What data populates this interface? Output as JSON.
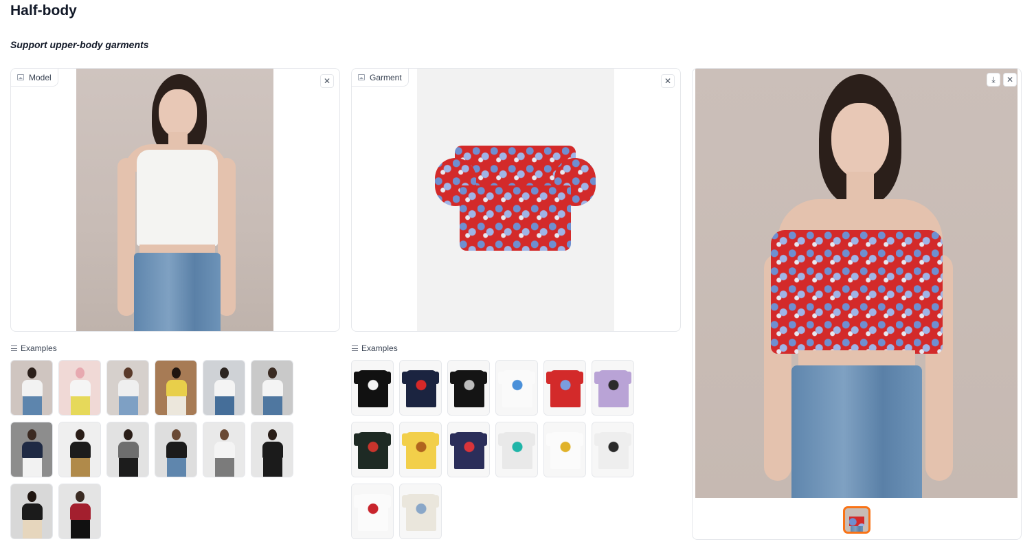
{
  "header": {
    "title": "Half-body",
    "subtitle": "Support upper-body garments"
  },
  "model_panel": {
    "label": "Model",
    "clear_icon": "close-icon"
  },
  "garment_panel": {
    "label": "Garment",
    "clear_icon": "close-icon"
  },
  "result_panel": {
    "download_icon": "download-icon",
    "close_icon": "close-icon"
  },
  "model_examples": {
    "label": "Examples",
    "items": [
      {
        "bg": "#cfc5c0",
        "head": "#2b1f1a",
        "top": "#f2f2f2",
        "bottom": "#5d85ad"
      },
      {
        "bg": "#f0d9d6",
        "head": "#e7a9b0",
        "top": "#f5f5f5",
        "bottom": "#e6d95a"
      },
      {
        "bg": "#d6d0cc",
        "head": "#5a3a2a",
        "top": "#efefef",
        "bottom": "#7ea0c4"
      },
      {
        "bg": "#a77b55",
        "head": "#1f1510",
        "top": "#e8cf4a",
        "bottom": "#ece7dc"
      },
      {
        "bg": "#cfd2d6",
        "head": "#2b2420",
        "top": "#f4f4f4",
        "bottom": "#456e99"
      },
      {
        "bg": "#c9c9c9",
        "head": "#3a2b22",
        "top": "#f4f4f4",
        "bottom": "#4f77a0"
      },
      {
        "bg": "#8d8d8d",
        "head": "#3b2a22",
        "top": "#1f2a44",
        "bottom": "#f2f2f2"
      },
      {
        "bg": "#efefef",
        "head": "#2a1e18",
        "top": "#1c1c1c",
        "bottom": "#b08a4a"
      },
      {
        "bg": "#e2e2e2",
        "head": "#2a1e18",
        "top": "#6e6e6e",
        "bottom": "#1c1c1c"
      },
      {
        "bg": "#dedede",
        "head": "#6a4a35",
        "top": "#1b1b1b",
        "bottom": "#5f86ad"
      },
      {
        "bg": "#e9e9e9",
        "head": "#6a4a35",
        "top": "#f4f4f4",
        "bottom": "#7b7b7b"
      },
      {
        "bg": "#e6e6e6",
        "head": "#2a1e18",
        "top": "#1b1b1b",
        "bottom": "#1b1b1b"
      },
      {
        "bg": "#d8d8d8",
        "head": "#1f1510",
        "top": "#1b1b1b",
        "bottom": "#e6d6bd"
      },
      {
        "bg": "#e4e4e4",
        "head": "#3a2b22",
        "top": "#a31f2e",
        "bottom": "#111111"
      }
    ]
  },
  "garment_examples": {
    "label": "Examples",
    "items": [
      {
        "bg": "#f7f7f7",
        "shirt": "#111111",
        "accent": "#f3f3f3"
      },
      {
        "bg": "#f7f7f7",
        "shirt": "#1b2440",
        "accent": "#d62828"
      },
      {
        "bg": "#f7f7f7",
        "shirt": "#141414",
        "accent": "#bdbdbd"
      },
      {
        "bg": "#f7f7f7",
        "shirt": "#fafafa",
        "accent": "#4a90d9"
      },
      {
        "bg": "#f7f7f7",
        "shirt": "#d32a2a",
        "accent": "#7b9ee0"
      },
      {
        "bg": "#f7f7f7",
        "shirt": "#b9a3d6",
        "accent": "#2b2b2b"
      },
      {
        "bg": "#f7f7f7",
        "shirt": "#1e2a24",
        "accent": "#c9342c"
      },
      {
        "bg": "#f7f7f7",
        "shirt": "#f2cf4a",
        "accent": "#b0641e"
      },
      {
        "bg": "#f7f7f7",
        "shirt": "#2b2e5a",
        "accent": "#d9343a"
      },
      {
        "bg": "#f7f7f7",
        "shirt": "#e9e9e9",
        "accent": "#1fb5a8"
      },
      {
        "bg": "#f7f7f7",
        "shirt": "#fbfbfb",
        "accent": "#e0b22a"
      },
      {
        "bg": "#f7f7f7",
        "shirt": "#eeeeee",
        "accent": "#2a2a2a"
      },
      {
        "bg": "#f7f7f7",
        "shirt": "#fbfbfb",
        "accent": "#c8242c"
      },
      {
        "bg": "#f7f7f7",
        "shirt": "#eae6dc",
        "accent": "#8aa7c8"
      }
    ]
  }
}
